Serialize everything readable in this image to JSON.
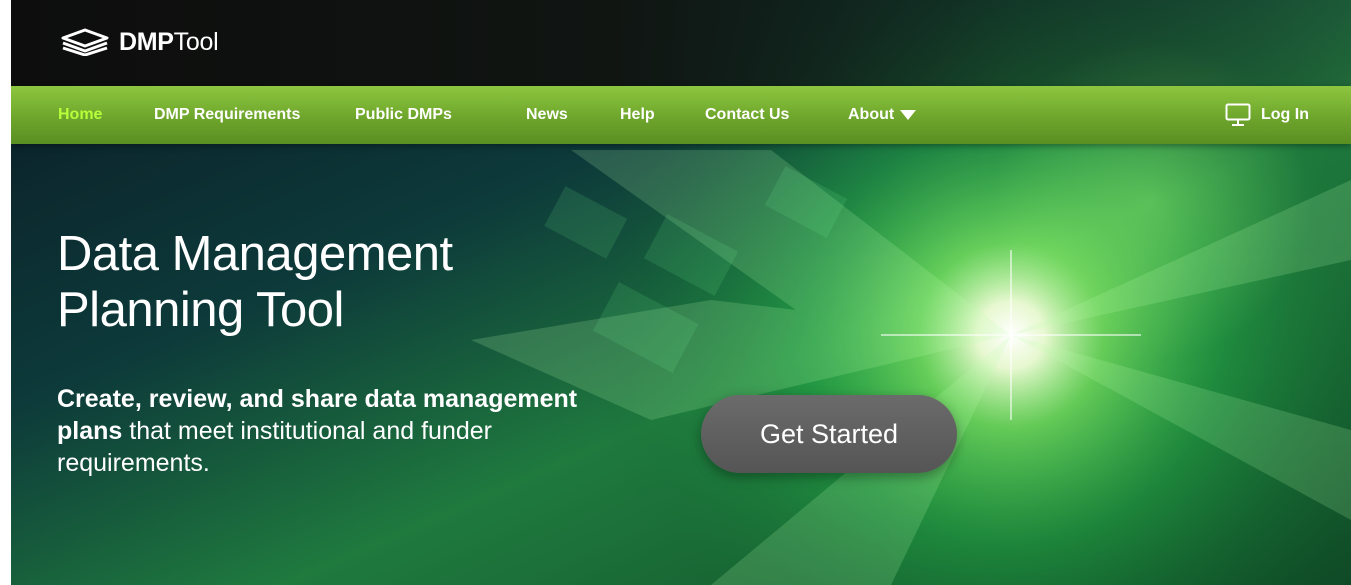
{
  "brand": {
    "logo_icon": "stacked-layers-icon",
    "name_bold": "DMP",
    "name_light": "Tool"
  },
  "nav": {
    "items": [
      {
        "label": "Home",
        "active": true
      },
      {
        "label": "DMP Requirements"
      },
      {
        "label": "Public DMPs"
      },
      {
        "label": "News"
      },
      {
        "label": "Help"
      },
      {
        "label": "Contact Us"
      },
      {
        "label": "About",
        "icon": "caret-down-icon"
      }
    ],
    "login": {
      "label": "Log In",
      "icon": "monitor-icon"
    },
    "active_color": "#b6ff3a",
    "bar_color": "#7ab637"
  },
  "hero": {
    "title_line1": "Data Management",
    "title_line2": "Planning Tool",
    "subtitle_bold": "Create, review, and share data management plans",
    "subtitle_rest": " that meet institutional and funder requirements.",
    "cta_label": "Get Started",
    "accent_color": "#3fd06a"
  }
}
